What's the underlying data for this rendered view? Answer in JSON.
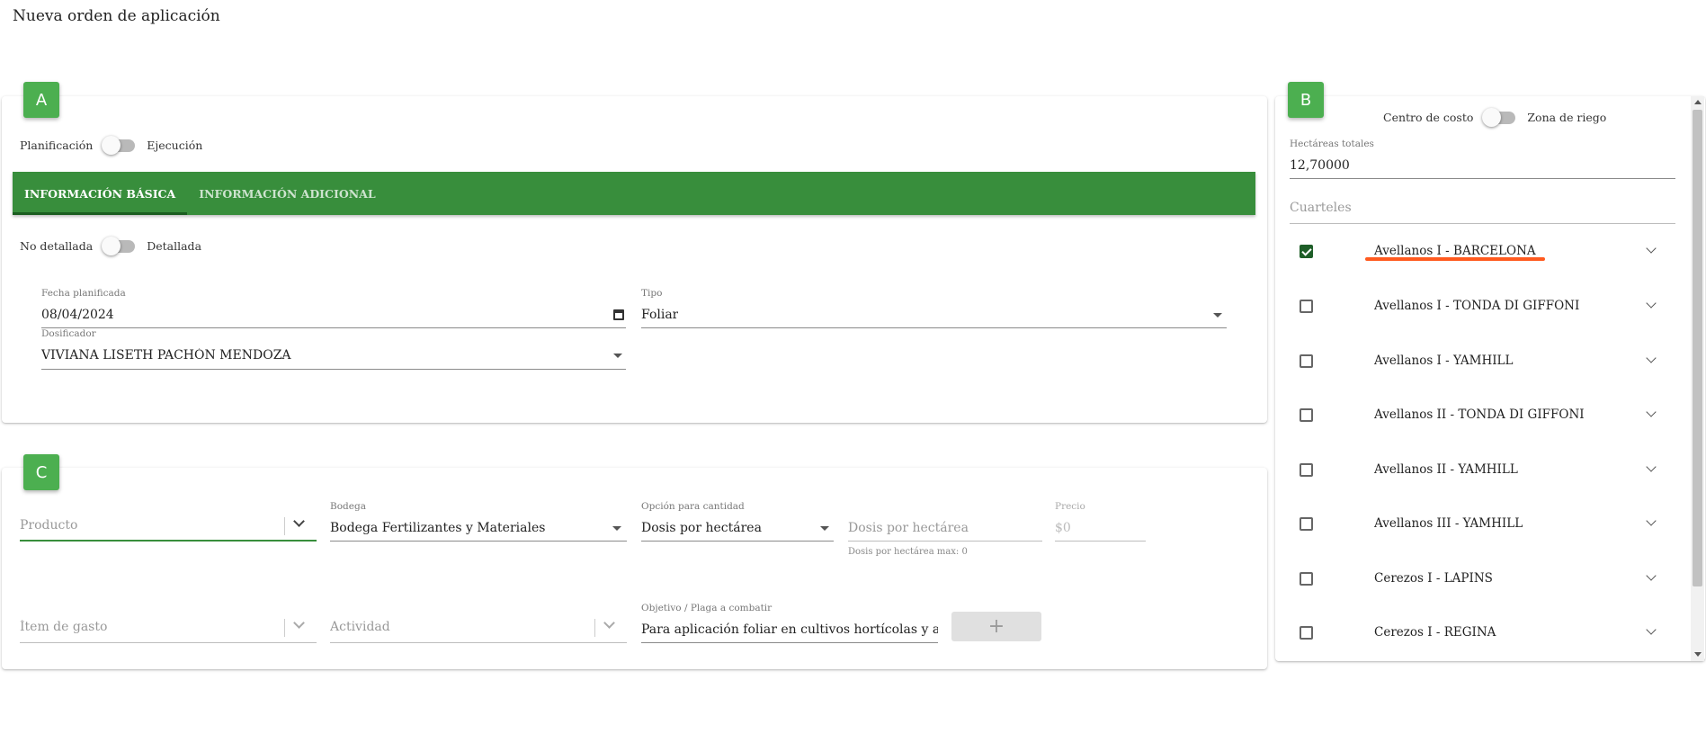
{
  "page": {
    "title": "Nueva orden de aplicación"
  },
  "section_a": {
    "badge": "A",
    "mode_toggle": {
      "left": "Planificación",
      "right": "Ejecución"
    },
    "tabs": [
      {
        "label": "Información básica",
        "active": true
      },
      {
        "label": "Información adicional",
        "active": false
      }
    ],
    "detail_toggle": {
      "left": "No detallada",
      "right": "Detallada"
    },
    "fecha": {
      "label": "Fecha planificada",
      "value": "08/04/2024"
    },
    "tipo": {
      "label": "Tipo",
      "value": "Foliar"
    },
    "dosificador": {
      "label": "Dosificador",
      "value": "VIVIANA LISETH PACHÓN MENDOZA"
    }
  },
  "section_b": {
    "badge": "B",
    "toggle": {
      "left": "Centro de costo",
      "right": "Zona de riego"
    },
    "hectareas": {
      "label": "Hectáreas totales",
      "value": "12,70000"
    },
    "cuarteles": {
      "placeholder": "Cuarteles"
    },
    "items": [
      {
        "label": "Avellanos I - BARCELONA",
        "checked": true
      },
      {
        "label": "Avellanos I - TONDA DI GIFFONI",
        "checked": false
      },
      {
        "label": "Avellanos I - YAMHILL",
        "checked": false
      },
      {
        "label": "Avellanos II - TONDA DI GIFFONI",
        "checked": false
      },
      {
        "label": "Avellanos II - YAMHILL",
        "checked": false
      },
      {
        "label": "Avellanos III - YAMHILL",
        "checked": false
      },
      {
        "label": "Cerezos I - LAPINS",
        "checked": false
      },
      {
        "label": "Cerezos I - REGINA",
        "checked": false
      }
    ]
  },
  "section_c": {
    "badge": "C",
    "producto": {
      "placeholder": "Producto"
    },
    "bodega": {
      "label": "Bodega",
      "value": "Bodega Fertilizantes y Materiales"
    },
    "opcion": {
      "label": "Opción para cantidad",
      "value": "Dosis por hectárea"
    },
    "dosis": {
      "placeholder": "Dosis por hectárea",
      "hint": "Dosis por hectárea max: 0"
    },
    "precio": {
      "label": "Precio",
      "placeholder": "$0"
    },
    "item_gasto": {
      "placeholder": "Ítem de gasto"
    },
    "actividad": {
      "placeholder": "Actividad"
    },
    "objetivo": {
      "label": "Objetivo / Plaga a combatir",
      "value": "Para aplicación foliar en cultivos hortícolas y agrícolas"
    },
    "add_button": "+"
  },
  "colors": {
    "primary_green": "#388e3c",
    "badge_green": "#4caf50",
    "annotation": "#ff5a1f"
  }
}
